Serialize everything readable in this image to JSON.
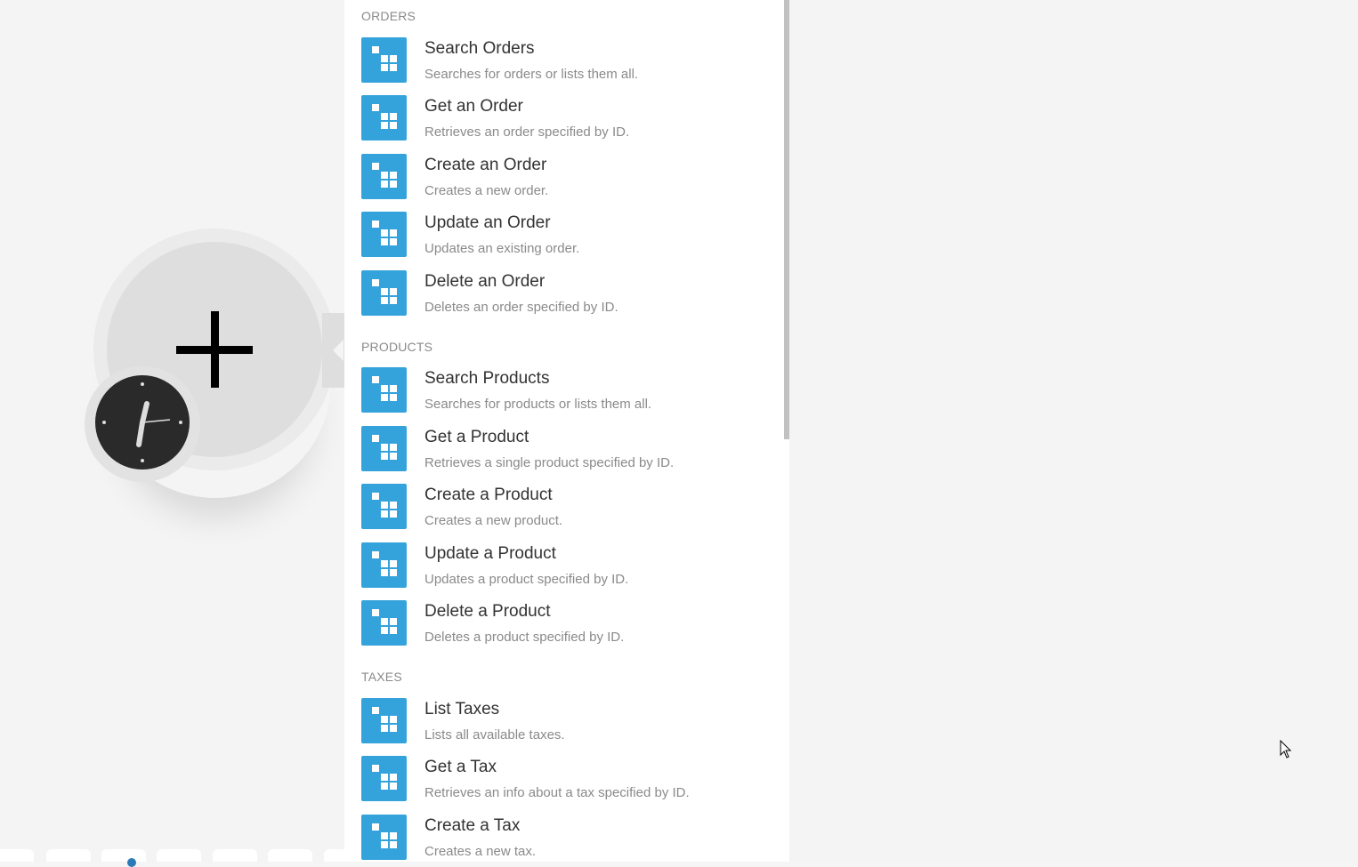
{
  "sections": [
    {
      "header": "ORDERS",
      "items": [
        {
          "title": "Search Orders",
          "desc": "Searches for orders or lists them all."
        },
        {
          "title": "Get an Order",
          "desc": "Retrieves an order specified by ID."
        },
        {
          "title": "Create an Order",
          "desc": "Creates a new order."
        },
        {
          "title": "Update an Order",
          "desc": "Updates an existing order."
        },
        {
          "title": "Delete an Order",
          "desc": "Deletes an order specified by ID."
        }
      ]
    },
    {
      "header": "PRODUCTS",
      "items": [
        {
          "title": "Search Products",
          "desc": "Searches for products or lists them all."
        },
        {
          "title": "Get a Product",
          "desc": "Retrieves a single product specified by ID."
        },
        {
          "title": "Create a Product",
          "desc": "Creates a new product."
        },
        {
          "title": "Update a Product",
          "desc": "Updates a product specified by ID."
        },
        {
          "title": "Delete a Product",
          "desc": "Deletes a product specified by ID."
        }
      ]
    },
    {
      "header": "TAXES",
      "items": [
        {
          "title": "List Taxes",
          "desc": "Lists all available taxes."
        },
        {
          "title": "Get a Tax",
          "desc": "Retrieves an info about a tax specified by ID."
        },
        {
          "title": "Create a Tax",
          "desc": "Creates a new tax."
        }
      ]
    }
  ],
  "icons": {
    "module_icon": "app-grid-icon",
    "add_module": "plus-icon",
    "schedule": "clock-icon",
    "cursor": "mouse-cursor-icon"
  },
  "colors": {
    "app_icon_bg": "#35a3db",
    "section_header": "#8a8a8a",
    "title": "#333333",
    "desc": "#8a8a8a"
  }
}
